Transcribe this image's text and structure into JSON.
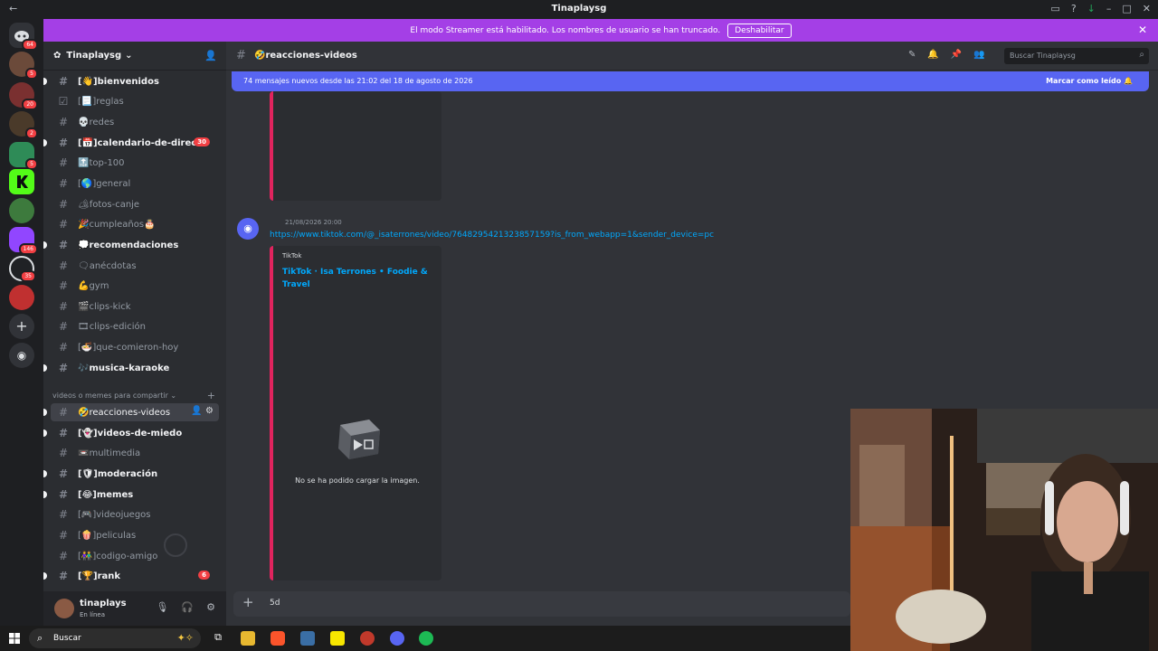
{
  "window": {
    "title": "Tinaplaysg"
  },
  "banner": {
    "text": "El modo Streamer está habilitado. Los nombres de usuario se han truncado.",
    "button": "Deshabilitar"
  },
  "servers": {
    "badges": [
      "64",
      "5",
      "20",
      "2",
      "5",
      "146",
      "35"
    ]
  },
  "guild": {
    "name": "Tinaplaysg"
  },
  "channels": [
    {
      "name": "[👋]bienvenidos",
      "state": "unread"
    },
    {
      "name": "[📃]reglas",
      "state": "muted"
    },
    {
      "name": "💀redes",
      "state": "muted"
    },
    {
      "name": "[📅]calendario-de-directo",
      "state": "unread",
      "badge": "30"
    },
    {
      "name": "🔝top-100",
      "state": "muted"
    },
    {
      "name": "[🌎]general",
      "state": "muted"
    },
    {
      "name": "🏕fotos-canje",
      "state": "muted"
    },
    {
      "name": "🎉cumpleaños🎂",
      "state": "muted"
    },
    {
      "name": "💭recomendaciones",
      "state": "unread"
    },
    {
      "name": "🗨anécdotas",
      "state": "muted"
    },
    {
      "name": "💪gym",
      "state": "muted"
    },
    {
      "name": "🎬clips-kick",
      "state": "muted"
    },
    {
      "name": "🎞clips-edición",
      "state": "muted"
    },
    {
      "name": "[🍜]que-comieron-hoy",
      "state": "muted"
    },
    {
      "name": "🎶musica-karaoke",
      "state": "unread"
    }
  ],
  "category": {
    "name": "videos o memes para compartir"
  },
  "channels2": [
    {
      "name": "🤣reacciones-videos",
      "state": "active"
    },
    {
      "name": "[👻]videos-de-miedo",
      "state": "unread"
    },
    {
      "name": "📼multimedia",
      "state": "muted"
    },
    {
      "name": "[🛡]moderación",
      "state": "unread"
    },
    {
      "name": "[😂]memes",
      "state": "unread"
    },
    {
      "name": "[🎮]videojuegos",
      "state": "muted"
    },
    {
      "name": "[🍿]peliculas",
      "state": "muted"
    },
    {
      "name": "[👫]codigo-amigo",
      "state": "muted"
    },
    {
      "name": "[🏆]rank",
      "state": "unread",
      "badge": "6"
    }
  ],
  "user": {
    "name": "tinaplays",
    "status": "En línea"
  },
  "chat": {
    "channel": "🤣reacciones-videos",
    "search_placeholder": "Buscar Tinaplaysg",
    "new_messages": "74 mensajes nuevos desde las 21:02 del 18 de agosto de 2026",
    "mark_read": "Marcar como leído",
    "message": {
      "time": "21/08/2026 20:00",
      "link": "https://www.tiktok.com/@_isaterrones/video/7648295421323857159?is_from_webapp=1&sender_device=pc",
      "embed_provider": "TikTok",
      "embed_title": "TikTok · Isa Terrones • Foodie & Travel",
      "image_error": "No se ha podido cargar la imagen."
    },
    "composer_text": "5d"
  },
  "taskbar": {
    "search": "Buscar"
  },
  "colors": {
    "accent": "#5865f2",
    "banner": "#a43fe6",
    "embed_border": "#e0245e",
    "link": "#00a8fc"
  }
}
